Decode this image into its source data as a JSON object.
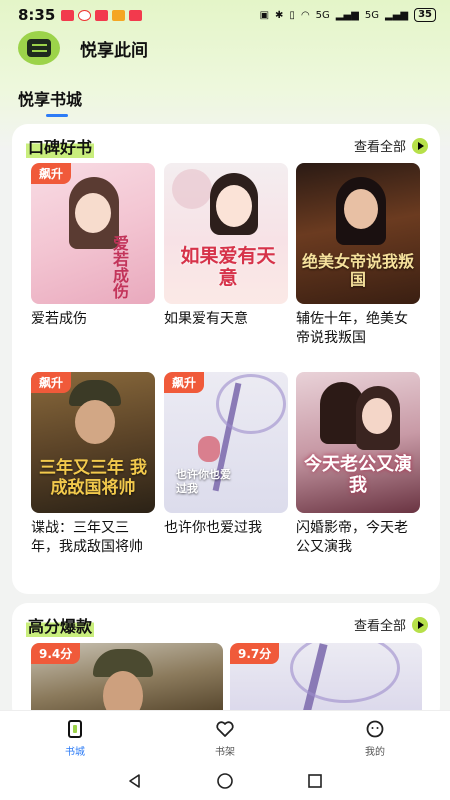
{
  "status": {
    "time": "8:35",
    "signal1": "5G",
    "signal2": "5G",
    "battery": "35"
  },
  "app": {
    "title": "悦享此间"
  },
  "tab": {
    "label": "悦享书城"
  },
  "sections": [
    {
      "title": "口碑好书",
      "view_all": "查看全部",
      "books": [
        {
          "title": "爱若成伤",
          "badge": "飙升",
          "cover_text": "爱若成伤"
        },
        {
          "title": "如果爱有天意",
          "badge": "",
          "cover_text": "如果爱有天意"
        },
        {
          "title": "辅佐十年，绝美女帝说我叛国",
          "badge": "",
          "cover_text": "绝美女帝说我叛国"
        },
        {
          "title": "谍战：三年又三年，我成敌国将帅",
          "badge": "飙升",
          "cover_text": "三年又三年 我成敌国将帅"
        },
        {
          "title": "也许你也爱过我",
          "badge": "飙升",
          "cover_text": "也许你也爱过我"
        },
        {
          "title": "闪婚影帝，今天老公又演我",
          "badge": "",
          "cover_text": "今天老公又演我"
        }
      ]
    },
    {
      "title": "高分爆款",
      "view_all": "查看全部",
      "books": [
        {
          "badge": "9.4分"
        },
        {
          "badge": "9.7分"
        }
      ]
    }
  ],
  "nav": [
    {
      "label": "书城",
      "active": true
    },
    {
      "label": "书架",
      "active": false
    },
    {
      "label": "我的",
      "active": false
    }
  ]
}
